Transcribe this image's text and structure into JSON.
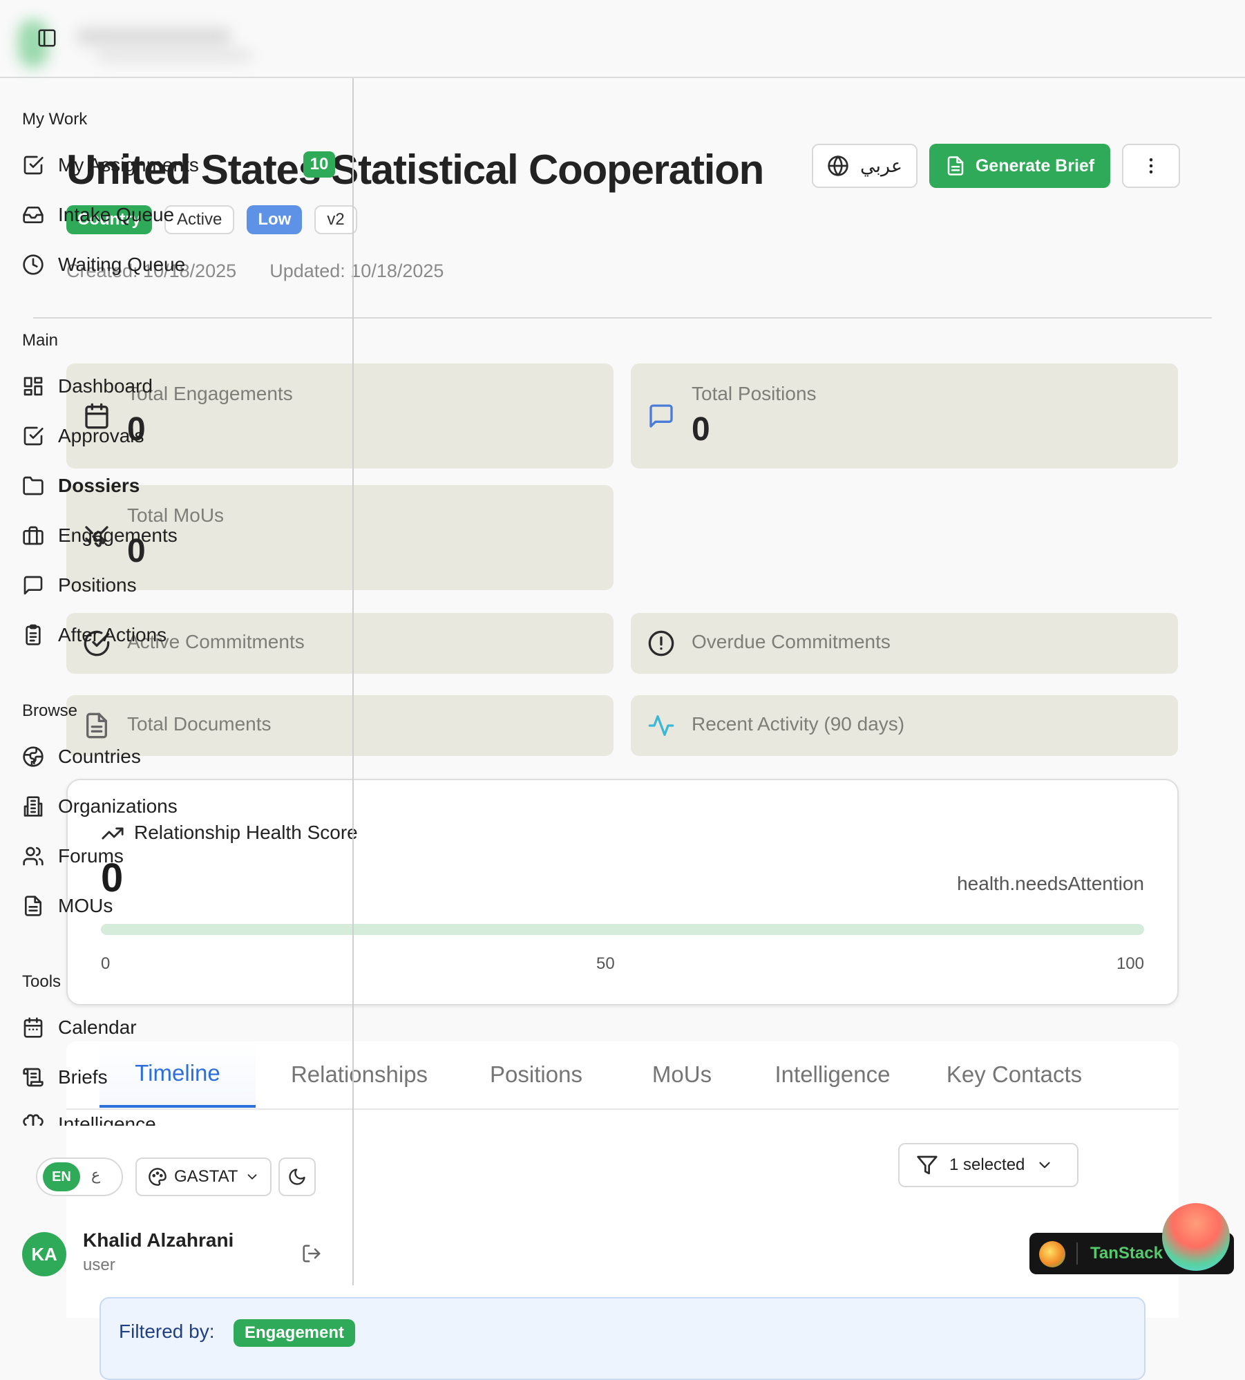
{
  "header": {
    "sidebar_toggle": "panel-left-icon"
  },
  "page": {
    "title": "United States Statistical Cooperation",
    "badges": [
      "Country",
      "Active",
      "Low",
      "v2"
    ],
    "created": "Created: 10/18/2025",
    "updated": "Updated: 10/18/2025",
    "actions": {
      "language_label": "عربي",
      "generate_brief_label": "Generate Brief"
    }
  },
  "stats": {
    "total_engagements": {
      "label": "Total Engagements",
      "value": "0"
    },
    "total_positions": {
      "label": "Total Positions",
      "value": "0"
    },
    "total_mous": {
      "label": "Total MoUs",
      "value": "0"
    },
    "active_commitments": {
      "label": "Active Commitments"
    },
    "overdue_commitments": {
      "label": "Overdue Commitments"
    },
    "total_documents": {
      "label": "Total Documents"
    },
    "recent_activity": {
      "label": "Recent Activity (90 days)"
    }
  },
  "health": {
    "title": "Relationship Health Score",
    "score": "0",
    "score_fraction": 0,
    "status": "health.needsAttention",
    "ticks": [
      "0",
      "50",
      "100"
    ]
  },
  "tabs": [
    "Timeline",
    "Relationships",
    "Positions",
    "MoUs",
    "Intelligence",
    "Key Contacts"
  ],
  "active_tab": "Timeline",
  "filter": {
    "button_label": "1 selected",
    "filtered_by_label": "Filtered by:",
    "chip": "Engagement"
  },
  "sidebar": {
    "sections": {
      "my_work": "My Work",
      "main": "Main",
      "browse": "Browse",
      "tools": "Tools"
    },
    "my_work": [
      {
        "label": "My Assignments",
        "icon": "check-square-icon",
        "badge": "10"
      },
      {
        "label": "Intake Queue",
        "icon": "inbox-icon"
      },
      {
        "label": "Waiting Queue",
        "icon": "clock-icon"
      }
    ],
    "main": [
      {
        "label": "Dashboard",
        "icon": "layout-dashboard-icon"
      },
      {
        "label": "Approvals",
        "icon": "check-square-icon"
      },
      {
        "label": "Dossiers",
        "icon": "folder-icon"
      },
      {
        "label": "Engagements",
        "icon": "briefcase-icon"
      },
      {
        "label": "Positions",
        "icon": "message-square-icon"
      },
      {
        "label": "After Actions",
        "icon": "clipboard-list-icon"
      }
    ],
    "browse": [
      {
        "label": "Countries",
        "icon": "globe-icon"
      },
      {
        "label": "Organizations",
        "icon": "building-icon"
      },
      {
        "label": "Forums",
        "icon": "users-icon"
      },
      {
        "label": "MOUs",
        "icon": "file-text-icon"
      }
    ],
    "tools": [
      {
        "label": "Calendar",
        "icon": "calendar-icon"
      },
      {
        "label": "Briefs",
        "icon": "scroll-icon"
      },
      {
        "label": "Intelligence",
        "icon": "brain-icon"
      }
    ],
    "footer": {
      "lang_en": "EN",
      "lang_ar": "ع",
      "theme": "GASTAT",
      "user_initials": "KA",
      "user_name": "Khalid Alzahrani",
      "user_role": "user"
    }
  },
  "devtools": {
    "label": "TanStack"
  },
  "colors": {
    "brand_green": "#2faa58",
    "badge_blue": "#5d92e6",
    "tab_active": "#2e6fdc",
    "card_bg": "#e9e8de"
  }
}
